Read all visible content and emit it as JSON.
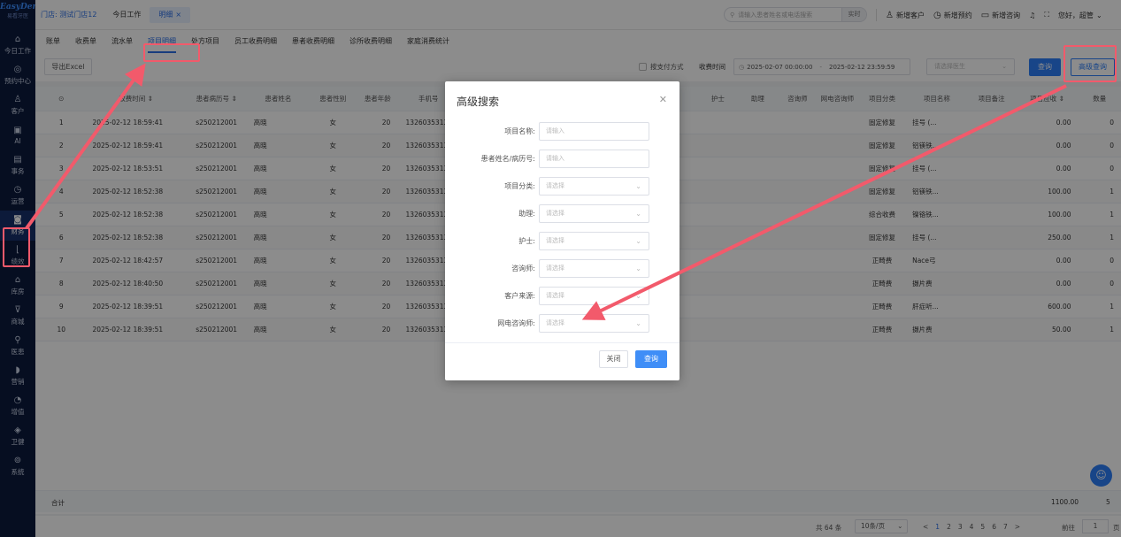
{
  "logo": {
    "brand": "EasyDent",
    "subtitle": "易看牙医"
  },
  "sidebar": {
    "items": [
      {
        "icon": "home-icon",
        "glyph": "⌂",
        "label": "今日工作"
      },
      {
        "icon": "calendar-icon",
        "glyph": "◎",
        "label": "预约中心"
      },
      {
        "icon": "user-icon",
        "glyph": "♙",
        "label": "客户"
      },
      {
        "icon": "ai-icon",
        "glyph": "▣",
        "label": "AI"
      },
      {
        "icon": "task-icon",
        "glyph": "▤",
        "label": "事务"
      },
      {
        "icon": "clock-icon",
        "glyph": "◷",
        "label": "运营"
      },
      {
        "icon": "wallet-icon",
        "glyph": "◙",
        "label": "财务"
      },
      {
        "icon": "chart-icon",
        "glyph": "⌊",
        "label": "绩效"
      },
      {
        "icon": "warehouse-icon",
        "glyph": "⌂",
        "label": "库房"
      },
      {
        "icon": "cart-icon",
        "glyph": "⊽",
        "label": "商城"
      },
      {
        "icon": "doctor-icon",
        "glyph": "⚲",
        "label": "医患"
      },
      {
        "icon": "megaphone-icon",
        "glyph": "◗",
        "label": "营销"
      },
      {
        "icon": "growth-icon",
        "glyph": "◔",
        "label": "增值"
      },
      {
        "icon": "shield-icon",
        "glyph": "◈",
        "label": "卫健"
      },
      {
        "icon": "settings-icon",
        "glyph": "⊚",
        "label": "系统"
      }
    ]
  },
  "header": {
    "store": "门店: 测试门店12",
    "tabs": [
      {
        "label": "今日工作"
      },
      {
        "label": "明细",
        "close": "×"
      }
    ],
    "search_placeholder": "请输入患者姓名或电话搜索",
    "search_button": "实时",
    "actions": [
      "新增客户",
      "新增预约",
      "新增咨询"
    ],
    "greeting": "您好，超管"
  },
  "subtabs": [
    "账单",
    "收费单",
    "流水单",
    "项目明细",
    "处方项目",
    "员工收费明细",
    "患者收费明细",
    "诊所收费明细",
    "家庭消费统计"
  ],
  "toolbar": {
    "export_label": "导出Excel",
    "checkbox_label": "按支付方式",
    "time_label": "收费时间",
    "date_start": "2025-02-07 00:00:00",
    "date_end": "2025-02-12 23:59:59",
    "doctor_placeholder": "请选择医生",
    "query_label": "查询",
    "advanced_label": "高级查询"
  },
  "table": {
    "columns": [
      "⊙",
      "收费时间 ⇕",
      "患者病历号 ⇕",
      "患者姓名",
      "患者性别",
      "患者年龄",
      "手机号",
      "",
      "",
      "",
      "",
      "",
      "",
      "护士",
      "助理",
      "咨询师",
      "网电咨询师",
      "项目分类",
      "项目名称",
      "项目备注",
      "项目应收 ⇕",
      "数量"
    ],
    "rows": [
      [
        "1",
        "2025-02-12 18:59:41",
        "s250212001",
        "高晓",
        "女",
        "20",
        "13260353135",
        "固定修复",
        "挂号 (...",
        "0.00",
        "0"
      ],
      [
        "2",
        "2025-02-12 18:59:41",
        "s250212001",
        "高晓",
        "女",
        "20",
        "13260353135",
        "固定修复",
        "铝镁铁...",
        "0.00",
        "0"
      ],
      [
        "3",
        "2025-02-12 18:53:51",
        "s250212001",
        "高晓",
        "女",
        "20",
        "13260353135",
        "固定修复",
        "挂号 (...",
        "0.00",
        "0"
      ],
      [
        "4",
        "2025-02-12 18:52:38",
        "s250212001",
        "高晓",
        "女",
        "20",
        "13260353135",
        "固定修复",
        "铝镁铁...",
        "100.00",
        "1"
      ],
      [
        "5",
        "2025-02-12 18:52:38",
        "s250212001",
        "高晓",
        "女",
        "20",
        "13260353135",
        "综合收费",
        "镍铬铁...",
        "100.00",
        "1"
      ],
      [
        "6",
        "2025-02-12 18:52:38",
        "s250212001",
        "高晓",
        "女",
        "20",
        "13260353135",
        "固定修复",
        "挂号 (...",
        "250.00",
        "1"
      ],
      [
        "7",
        "2025-02-12 18:42:57",
        "s250212001",
        "高晓",
        "女",
        "20",
        "13260353135",
        "正畸费",
        "Nace弓",
        "0.00",
        "0"
      ],
      [
        "8",
        "2025-02-12 18:40:50",
        "s250212001",
        "高晓",
        "女",
        "20",
        "13260353135",
        "正畸费",
        "摄片费",
        "0.00",
        "0"
      ],
      [
        "9",
        "2025-02-12 18:39:51",
        "s250212001",
        "高晓",
        "女",
        "20",
        "13260353135",
        "正畸费",
        "肝症听...",
        "600.00",
        "1"
      ],
      [
        "10",
        "2025-02-12 18:39:51",
        "s250212001",
        "高晓",
        "女",
        "20",
        "13260353135",
        "正畸费",
        "摄片费",
        "50.00",
        "1"
      ]
    ],
    "sum_label": "合计",
    "sum_amount": "1100.00",
    "sum_count": "5"
  },
  "pager": {
    "total": "共 64 条",
    "page_size": "10条/页",
    "pages": [
      "<",
      "1",
      "2",
      "3",
      "4",
      "5",
      "6",
      "7",
      ">"
    ],
    "goto_label": "前往",
    "goto_value": "1",
    "page_suffix": "页"
  },
  "modal": {
    "title": "高级搜索",
    "fields": [
      {
        "label": "项目名称:",
        "placeholder": "请输入",
        "type": "input"
      },
      {
        "label": "患者姓名/病历号:",
        "placeholder": "请输入",
        "type": "input"
      },
      {
        "label": "项目分类:",
        "placeholder": "请选择",
        "type": "select"
      },
      {
        "label": "助理:",
        "placeholder": "请选择",
        "type": "select"
      },
      {
        "label": "护士:",
        "placeholder": "请选择",
        "type": "select"
      },
      {
        "label": "咨询师:",
        "placeholder": "请选择",
        "type": "select"
      },
      {
        "label": "客户来源:",
        "placeholder": "请选择",
        "type": "select"
      },
      {
        "label": "网电咨询师:",
        "placeholder": "请选择",
        "type": "select"
      }
    ],
    "close_label": "关闭",
    "query_label": "查询"
  },
  "colors": {
    "sidebar": "#0b1a3c",
    "accent": "#2c7ef8",
    "highlight": "#f25a6b"
  }
}
